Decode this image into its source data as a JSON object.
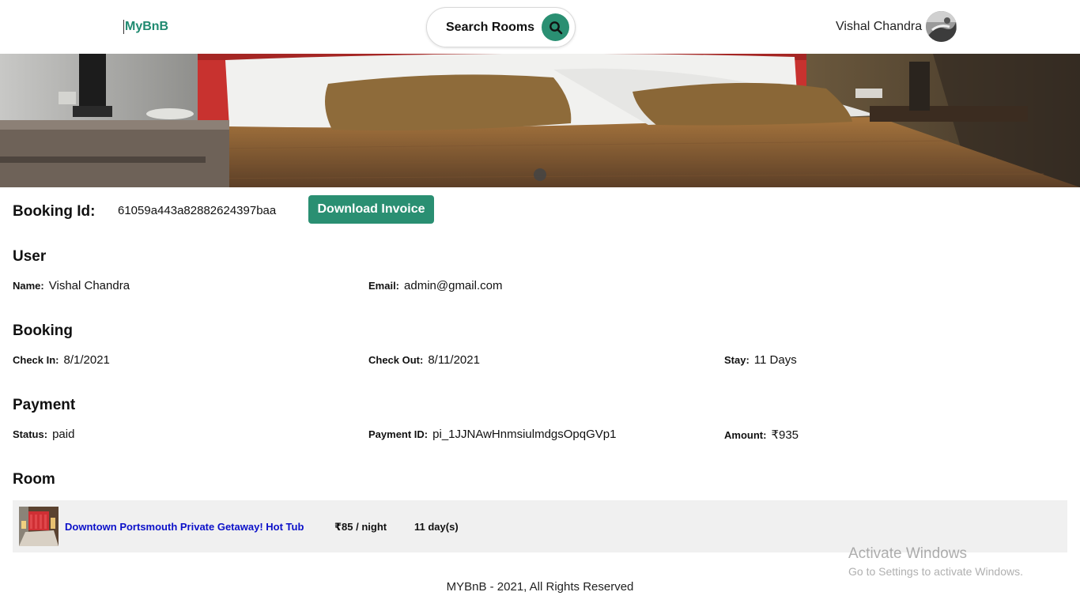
{
  "header": {
    "logo": "MyBnB",
    "search_label": "Search Rooms",
    "user_name": "Vishal Chandra",
    "icons": {
      "search": "search-icon",
      "avatar": "user-avatar"
    }
  },
  "colors": {
    "brand": "#2a8f72",
    "link": "#0b10c9",
    "row_bg": "#f0f0f0"
  },
  "booking": {
    "id_label": "Booking Id:",
    "id_value": "61059a443a82882624397baa",
    "download_label": "Download Invoice"
  },
  "user": {
    "title": "User",
    "name_label": "Name:",
    "name_value": "Vishal Chandra",
    "email_label": "Email:",
    "email_value": "admin@gmail.com"
  },
  "booking_details": {
    "title": "Booking",
    "check_in_label": "Check In:",
    "check_in_value": "8/1/2021",
    "check_out_label": "Check Out:",
    "check_out_value": "8/11/2021",
    "stay_label": "Stay:",
    "stay_value": "11 Days"
  },
  "payment": {
    "title": "Payment",
    "status_label": "Status:",
    "status_value": "paid",
    "payment_id_label": "Payment ID:",
    "payment_id_value": "pi_1JJNAwHnmsiulmdgsOpqGVp1",
    "amount_label": "Amount:",
    "amount_value": "₹935"
  },
  "room": {
    "title": "Room",
    "name": "Downtown Portsmouth Private Getaway! Hot Tub",
    "price": "₹85 / night",
    "days": "11 day(s)"
  },
  "footer": {
    "text": "MYBnB - 2021, All Rights Reserved"
  },
  "watermark": {
    "title": "Activate Windows",
    "subtitle": "Go to Settings to activate Windows."
  }
}
